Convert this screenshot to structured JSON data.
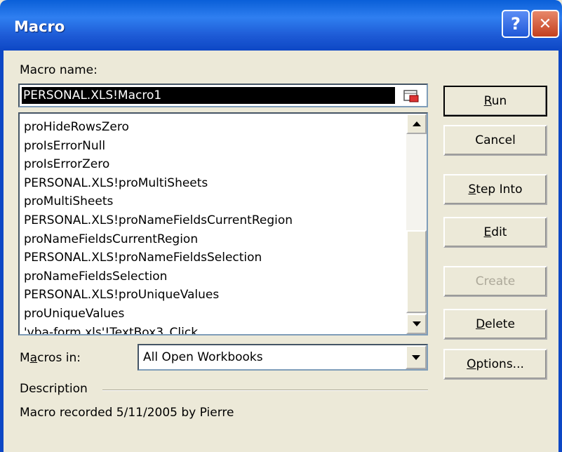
{
  "window": {
    "title": "Macro",
    "help_label": "?",
    "close_label": "✕"
  },
  "macro_name": {
    "label": "Macro name:",
    "value": "PERSONAL.XLS!Macro1"
  },
  "macro_list": [
    "proHideRowsZero",
    "proIsErrorNull",
    "proIsErrorZero",
    "PERSONAL.XLS!proMultiSheets",
    "proMultiSheets",
    "PERSONAL.XLS!proNameFieldsCurrentRegion",
    "proNameFieldsCurrentRegion",
    "PERSONAL.XLS!proNameFieldsSelection",
    "proNameFieldsSelection",
    "PERSONAL.XLS!proUniqueValues",
    "proUniqueValues",
    "'vba-form.xls'!TextBox3_Click"
  ],
  "buttons": {
    "run": "Run",
    "cancel": "Cancel",
    "step_into": "Step Into",
    "edit": "Edit",
    "create": "Create",
    "delete": "Delete",
    "options": "Options..."
  },
  "macros_in": {
    "label": "Macros in:",
    "value": "All Open Workbooks"
  },
  "description": {
    "label": "Description",
    "text": "Macro recorded 5/11/2005 by Pierre"
  },
  "icons": [
    "help-icon",
    "close-icon",
    "collapse-dialog-icon",
    "scroll-up-icon",
    "scroll-down-icon",
    "dropdown-arrow-icon"
  ],
  "colors": {
    "titlebar": "#0A5FD8",
    "dialog_bg": "#ECE9D8",
    "selection": "#000000"
  }
}
